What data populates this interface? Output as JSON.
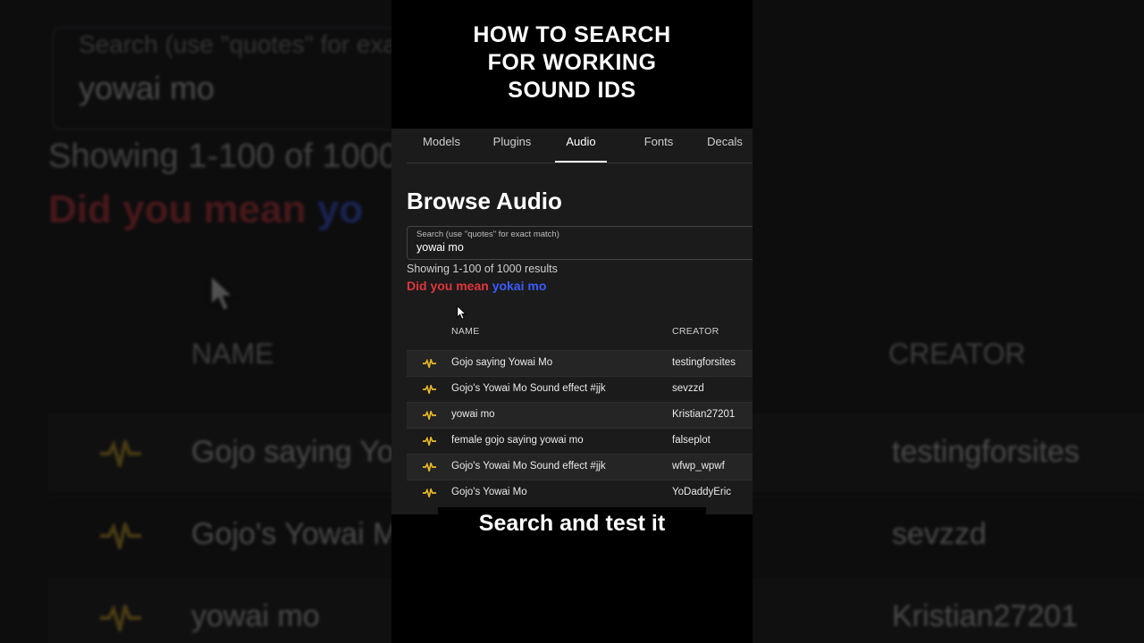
{
  "headline": "HOW TO SEARCH\nFOR WORKING\nSOUND IDS",
  "caption": "Search and test it",
  "tabs": [
    {
      "label": "Models"
    },
    {
      "label": "Plugins"
    },
    {
      "label": "Audio",
      "active": true
    },
    {
      "label": "Fonts"
    },
    {
      "label": "Decals"
    }
  ],
  "page_title": "Browse Audio",
  "search": {
    "label": "Search (use \"quotes\" for exact match)",
    "value": "yowai mo"
  },
  "results_text": "Showing 1-100 of 1000 results",
  "suggestion": {
    "prefix": "Did you mean",
    "term": "yokai mo"
  },
  "table": {
    "columns": [
      "NAME",
      "CREATOR"
    ],
    "rows": [
      {
        "name": "Gojo saying Yowai Mo",
        "creator": "testingforsites"
      },
      {
        "name": "Gojo's Yowai Mo Sound effect #jjk",
        "creator": "sevzzd"
      },
      {
        "name": "yowai mo",
        "creator": "Kristian27201"
      },
      {
        "name": "female gojo saying yowai mo",
        "creator": "falseplot"
      },
      {
        "name": "Gojo's Yowai Mo Sound effect #jjk",
        "creator": "wfwp_wpwf"
      },
      {
        "name": "Gojo's Yowai Mo",
        "creator": "YoDaddyEric"
      }
    ]
  },
  "background_zoom": {
    "search_label": "Search (use \"quotes\" for exa",
    "search_value": "yowai mo",
    "showing": "Showing 1-100 of 1000",
    "didyou_prefix": "Did you mean",
    "didyou_term": "yo",
    "col_name": "NAME",
    "col_creator": "CREATOR",
    "rows": [
      {
        "name": "Gojo saying Yo",
        "creator": "testingforsites"
      },
      {
        "name": "Gojo's Yowai M",
        "creator": "sevzzd"
      },
      {
        "name": "yowai mo",
        "creator": "Kristian27201"
      }
    ]
  },
  "icons": {
    "audio_row": "audio-wave-icon",
    "pointer": "cursor-arrow-icon"
  },
  "colors": {
    "accent_red": "#e0353b",
    "accent_blue": "#3b5bff",
    "wave_yellow": "#e8b923",
    "panel_bg": "#1b1b1c"
  }
}
